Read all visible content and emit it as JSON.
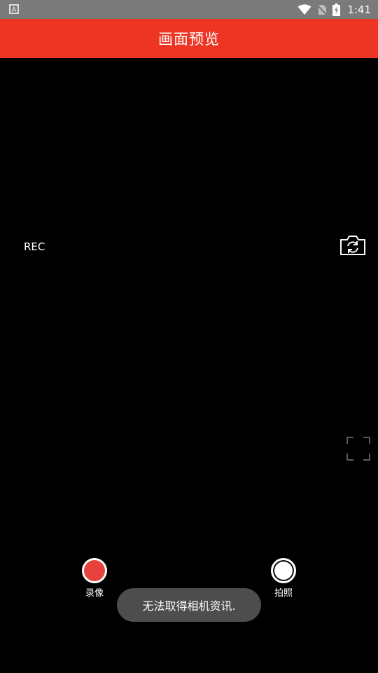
{
  "status_bar": {
    "time": "1:41",
    "icons": [
      "notification-a-icon",
      "wifi-icon",
      "no-sim-icon",
      "battery-charging-icon"
    ]
  },
  "app_bar": {
    "title": "画面预览",
    "color": "#ee3524"
  },
  "preview": {
    "rec_label": "REC",
    "switch_camera_icon": "switch-camera-icon",
    "fullscreen_icon": "fullscreen-icon"
  },
  "controls": {
    "record_label": "录像",
    "photo_label": "拍照",
    "record_color": "#e8413b"
  },
  "toast": {
    "message": "无法取得相机资讯."
  }
}
